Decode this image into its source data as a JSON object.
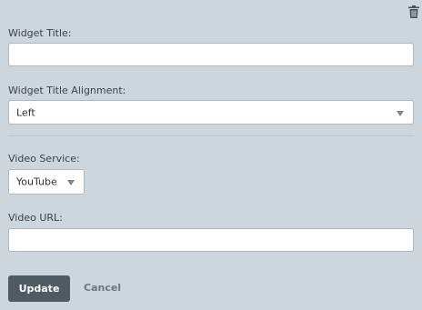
{
  "widget": {
    "delete_icon": "trash-icon",
    "title_label": "Widget Title:",
    "title_value": "",
    "alignment_label": "Widget Title Alignment:",
    "alignment_value": "Left",
    "video_service_label": "Video Service:",
    "video_service_value": "YouTube",
    "video_url_label": "Video URL:",
    "video_url_value": ""
  },
  "actions": {
    "update_label": "Update",
    "cancel_label": "Cancel"
  },
  "colors": {
    "background": "#cdd6dc",
    "update_button": "#4f5a63",
    "cancel_text": "#6c7780"
  }
}
